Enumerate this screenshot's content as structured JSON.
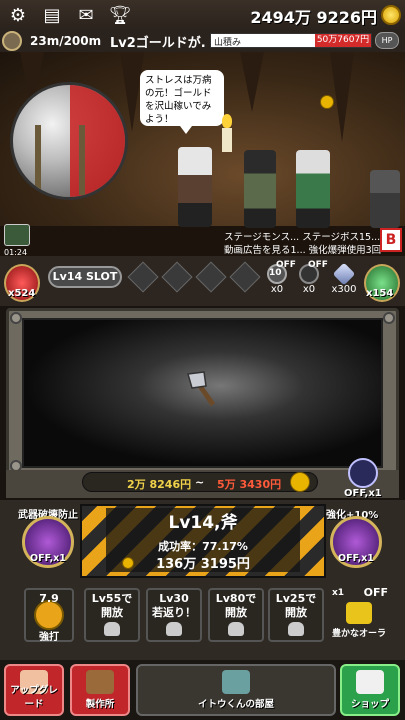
{
  "header": {
    "gold_total": "2494万 9226円",
    "icons": [
      "gear-icon",
      "profile-card-icon",
      "mail-icon",
      "trophy-icon",
      "gold-coin-icon"
    ]
  },
  "status": {
    "depth": "23m/200m",
    "quest_title": "Lv2ゴールドが...",
    "quest_bar_left": "山積み",
    "quest_bar_right": "50万7607円",
    "hp_badge": "HP"
  },
  "scene": {
    "speech": "ストレスは万病の元！ゴールドを沢山稼いでみよう！",
    "timer": "01:24",
    "mission_1": "ステージモンス... ステージボス15...",
    "mission_2": "動画広告を見る1... 強化爆弾使用3回",
    "mission_icon": "B"
  },
  "slot": {
    "potion_count": "x524",
    "label": "Lv14 SLOT",
    "res_1_count": "x0",
    "res_1_top": "10",
    "res_1_off": "OFF",
    "res_2_count": "x0",
    "res_2_off": "OFF",
    "res_3_count": "x300",
    "gem_count": "x154"
  },
  "forge": {
    "range_min": "2万 8246円",
    "range_sep": "~",
    "range_max": "5万 3430円",
    "right_off": "OFF,x1"
  },
  "enhance": {
    "left_label": "武器破壊防止",
    "left_state": "OFF,x1",
    "right_label": "強化+10%",
    "right_state": "OFF,x1",
    "title": "Lv14,斧",
    "rate": "成功率：77.17%",
    "cost": "136万 3195円"
  },
  "slots": {
    "strong_hit_value": "7.9",
    "strong_hit_label": "強打",
    "lock_1_line1": "Lv55で",
    "lock_1_line2": "開放",
    "lock_2_line1": "Lv30",
    "lock_2_line2": "若返り！",
    "lock_3_line1": "Lv80で",
    "lock_3_line2": "開放",
    "lock_4_line1": "Lv25で",
    "lock_4_line2": "開放",
    "aura_count": "x1",
    "aura_off": "OFF",
    "aura_label": "豊かなオーラ"
  },
  "nav": {
    "upgrade": "アップグレード",
    "crafting": "製作所",
    "room": "イトウくんの部屋",
    "shop": "ショップ"
  },
  "colors": {
    "gold": "#e8b400",
    "range_min": "#f0d24a",
    "range_max": "#ff5a3a",
    "hazard": "#e9a41a",
    "nav_red": "#c0262a",
    "nav_green": "#2aa14a"
  }
}
